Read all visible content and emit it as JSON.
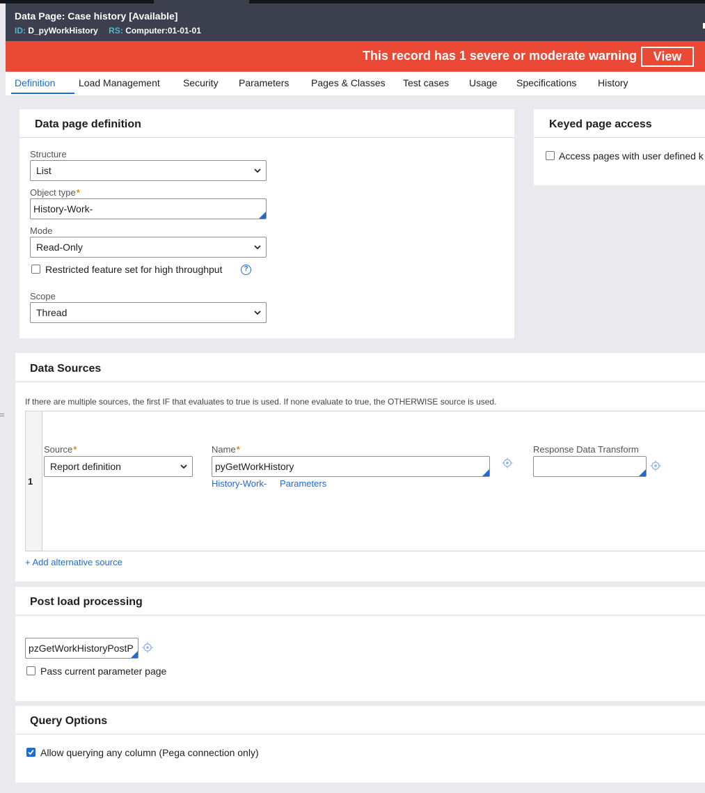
{
  "header": {
    "title": "Data Page: Case history",
    "status": "[Available]",
    "id_label": "ID:",
    "id_value": "D_pyWorkHistory",
    "rs_label": "RS:",
    "rs_value": "Computer:01-01-01"
  },
  "warning": {
    "message": "This record has 1 severe or moderate warning",
    "view_label": "View"
  },
  "tabs": [
    {
      "label": "Definition"
    },
    {
      "label": "Load Management"
    },
    {
      "label": "Security"
    },
    {
      "label": "Parameters"
    },
    {
      "label": "Pages & Classes"
    },
    {
      "label": "Test cases"
    },
    {
      "label": "Usage"
    },
    {
      "label": "Specifications"
    },
    {
      "label": "History"
    }
  ],
  "definition": {
    "title": "Data page definition",
    "structure_label": "Structure",
    "structure_value": "List",
    "object_type_label": "Object type",
    "object_type_value": "History-Work-",
    "mode_label": "Mode",
    "mode_value": "Read-Only",
    "restricted_label": "Restricted feature set for high throughput",
    "scope_label": "Scope",
    "scope_value": "Thread"
  },
  "keyed": {
    "title": "Keyed page access",
    "access_label": "Access pages with user defined k"
  },
  "sources": {
    "title": "Data Sources",
    "note": "If there are multiple sources, the first IF that evaluates to true is used. If none evaluate to true, the OTHERWISE source is used.",
    "row_number": "1",
    "source_label": "Source",
    "source_value": "Report definition",
    "name_label": "Name",
    "name_value": "pyGetWorkHistory",
    "class_link": "History-Work-",
    "params_link": "Parameters",
    "response_label": "Response Data Transform",
    "response_value": "",
    "add_link": "+ Add alternative source"
  },
  "postload": {
    "title": "Post load processing",
    "activity_value": "pzGetWorkHistoryPostP",
    "pass_label": "Pass current parameter page"
  },
  "query": {
    "title": "Query Options",
    "allow_label": "Allow querying any column (Pega connection only)"
  },
  "colors": {
    "header_bg": "#3b3f4e",
    "warning_bg": "#ea4a35",
    "accent": "#1f6bd4",
    "required": "#e08a1e"
  }
}
